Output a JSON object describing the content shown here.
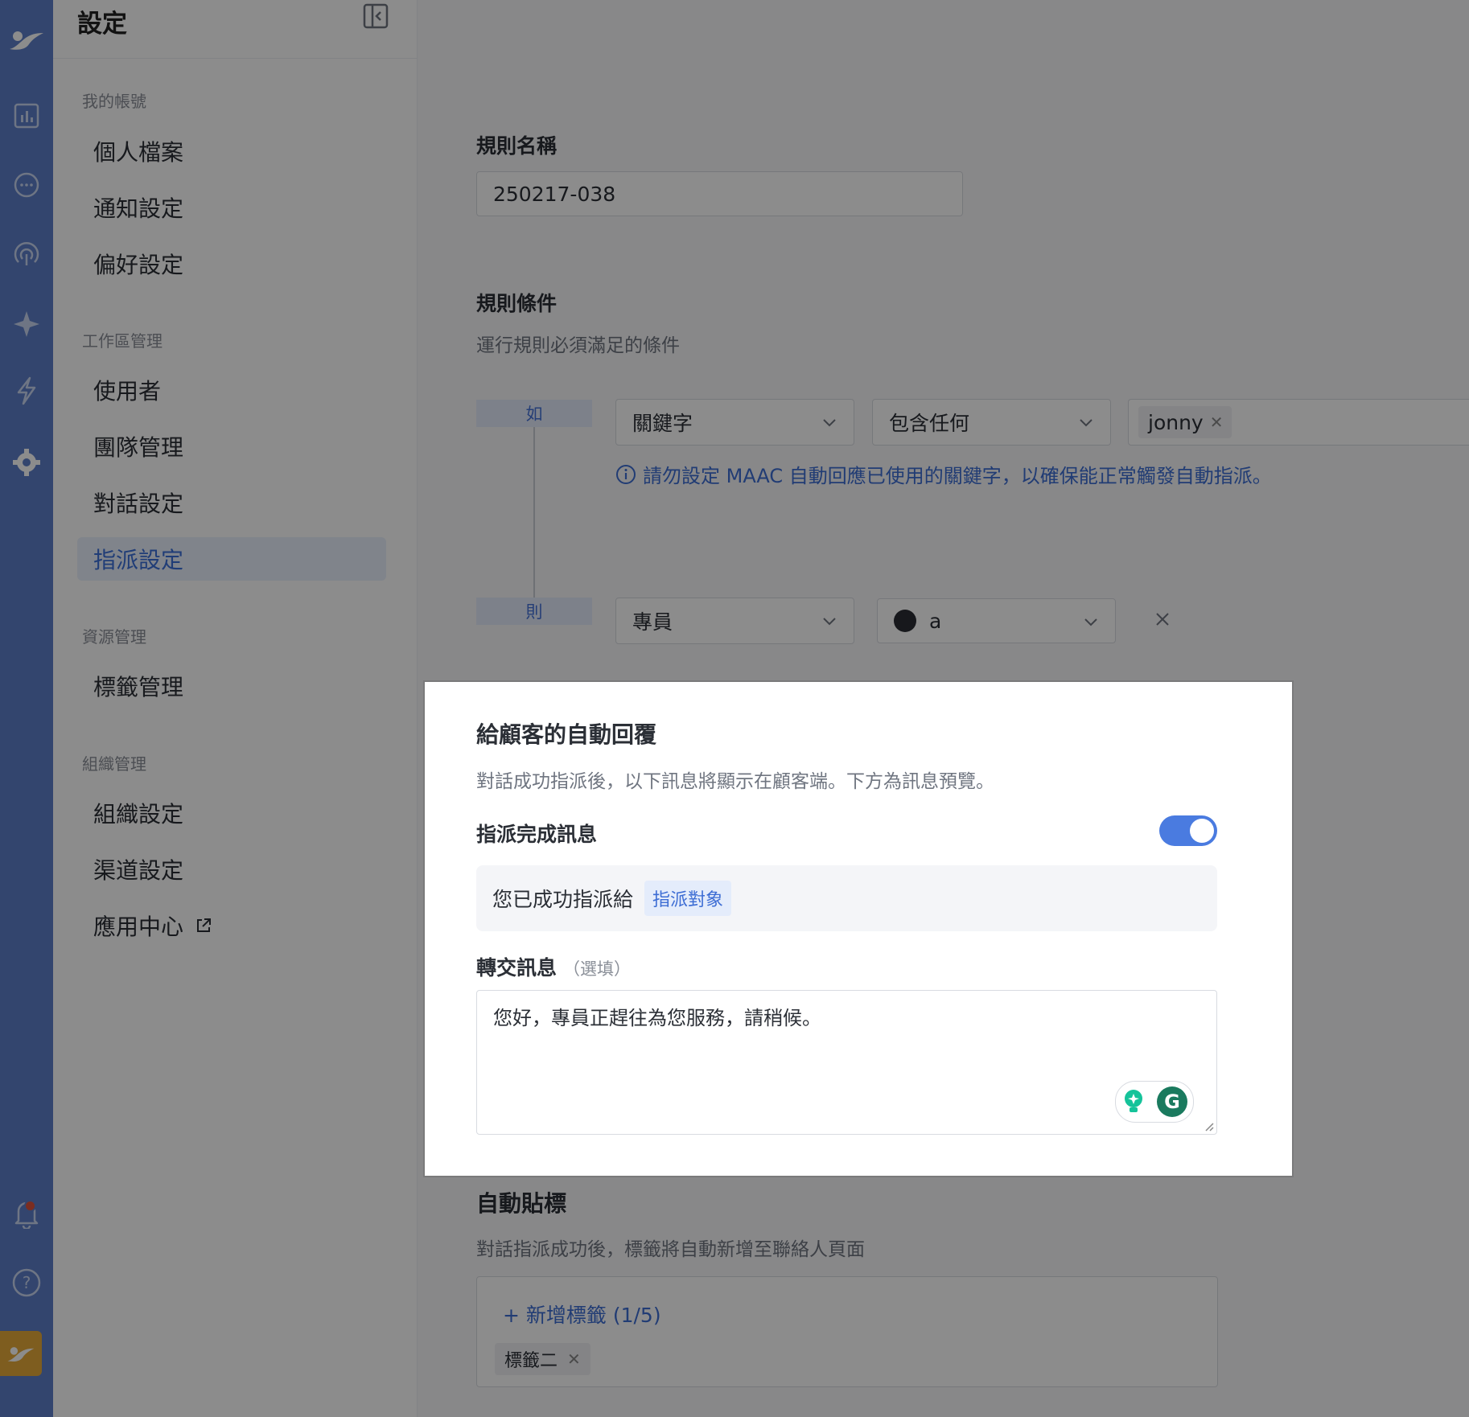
{
  "sidebar": {
    "title": "設定",
    "sections": [
      {
        "label": "我的帳號"
      },
      {
        "label": "工作區管理"
      },
      {
        "label": "資源管理"
      },
      {
        "label": "組織管理"
      }
    ],
    "items": [
      {
        "label": "個人檔案"
      },
      {
        "label": "通知設定"
      },
      {
        "label": "偏好設定"
      },
      {
        "label": "使用者"
      },
      {
        "label": "團隊管理"
      },
      {
        "label": "對話設定"
      },
      {
        "label": "指派設定",
        "active": true
      },
      {
        "label": "標籤管理"
      },
      {
        "label": "組織設定"
      },
      {
        "label": "渠道設定"
      },
      {
        "label": "應用中心"
      }
    ]
  },
  "rule": {
    "name_label": "規則名稱",
    "name_value": "250217-038",
    "conditions_label": "規則條件",
    "conditions_desc": "運行規則必須滿足的條件",
    "if_label": "如",
    "then_label": "則",
    "condition_field": "關鍵字",
    "condition_operator": "包含任何",
    "keyword_chip": "jonny",
    "warning": "請勿設定 MAAC 自動回應已使用的關鍵字，以確保能正常觸發自動指派。",
    "action_field": "專員",
    "action_agent": "a"
  },
  "modal": {
    "title": "給顧客的自動回覆",
    "desc": "對話成功指派後，以下訊息將顯示在顧客端。下方為訊息預覽。",
    "assign_label": "指派完成訊息",
    "toggle_on": true,
    "preview_text": "您已成功指派給",
    "preview_var": "指派對象",
    "transfer_label": "轉交訊息",
    "transfer_optional": "（選填）",
    "transfer_text": "您好，專員正趕往為您服務，請稍候。"
  },
  "autotag": {
    "title": "自動貼標",
    "desc": "對話指派成功後，標籤將自動新增至聯絡人頁面",
    "add_label": "+ 新增標籤 (1/5)",
    "tags": [
      {
        "label": "標籤二"
      }
    ]
  },
  "colors": {
    "rail": "#5d7ec9",
    "accent": "#3d6dd4",
    "active_rail": "#e6aa3a"
  }
}
